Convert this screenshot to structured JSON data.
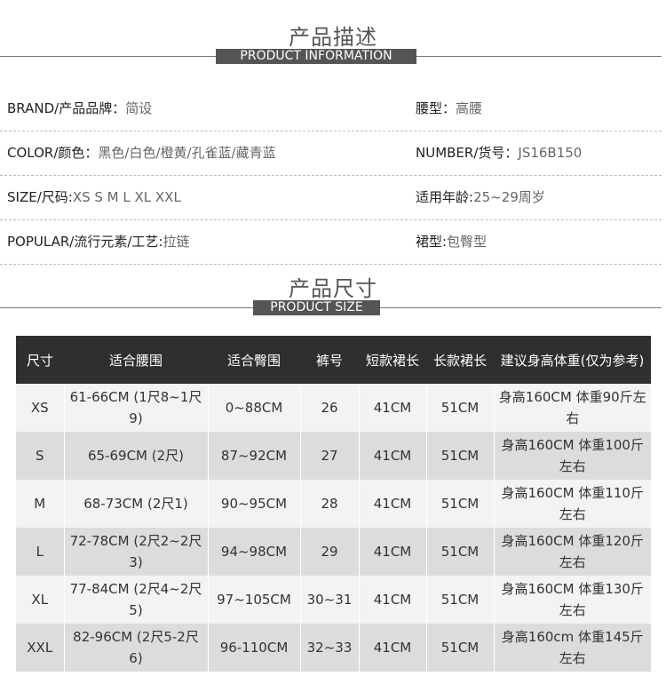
{
  "section_info": {
    "title_cn": "产品描述",
    "title_en": "PRODUCT INFORMATION"
  },
  "info_rows": [
    {
      "left_key": "BRAND/产品品牌：",
      "left_val": "简设",
      "right_key": "腰型：",
      "right_val": "高腰"
    },
    {
      "left_key": "COLOR/颜色：",
      "left_val": "黑色/白色/橙黄/孔雀蓝/藏青蓝",
      "right_key": "NUMBER/货号：",
      "right_val": "JS16B150"
    },
    {
      "left_key": "SIZE/尺码:",
      "left_val": "XS S M L XL XXL",
      "right_key": "适用年龄:",
      "right_val": "25~29周岁"
    },
    {
      "left_key": "POPULAR/流行元素/工艺:",
      "left_val": "拉链",
      "right_key": "裙型:",
      "right_val": "包臀型"
    }
  ],
  "section_size": {
    "title_cn": "产品尺寸",
    "title_en": "PRODUCT SIZE"
  },
  "size_table": {
    "headers": [
      "尺寸",
      "适合腰围",
      "适合臀围",
      "裤号",
      "短款裙长",
      "长款裙长",
      "建议身高体重(仅为参考)"
    ],
    "rows": [
      [
        "XS",
        "61-66CM (1尺8~1尺9)",
        "0~88CM",
        "26",
        "41CM",
        "51CM",
        "身高160CM 体重90斤左右"
      ],
      [
        "S",
        "65-69CM (2尺)",
        "87~92CM",
        "27",
        "41CM",
        "51CM",
        "身高160CM 体重100斤左右"
      ],
      [
        "M",
        "68-73CM (2尺1)",
        "90~95CM",
        "28",
        "41CM",
        "51CM",
        "身高160CM 体重110斤左右"
      ],
      [
        "L",
        "72-78CM (2尺2~2尺3)",
        "94~98CM",
        "29",
        "41CM",
        "51CM",
        "身高160CM 体重120斤左右"
      ],
      [
        "XL",
        "77-84CM (2尺4~2尺5)",
        "97~105CM",
        "30~31",
        "41CM",
        "51CM",
        "身高160CM 体重130斤左右"
      ],
      [
        "XXL",
        "82-96CM (2尺5-2尺6)",
        "96-110CM",
        "32~33",
        "41CM",
        "51CM",
        "身高160cm 体重145斤左右"
      ]
    ]
  }
}
